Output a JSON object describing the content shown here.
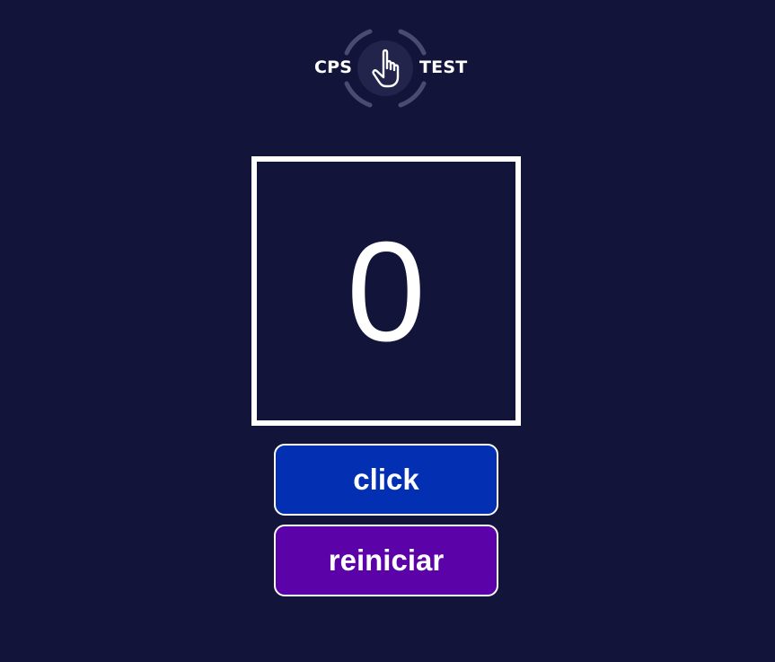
{
  "logo": {
    "left_text": "CPS",
    "right_text": "TEST",
    "icon": "pointer-hand-icon"
  },
  "counter": {
    "value": "0"
  },
  "buttons": {
    "click_label": "click",
    "reset_label": "reiniciar"
  },
  "colors": {
    "background": "#13143a",
    "click_button": "#0330b3",
    "reset_button": "#5b03a8",
    "ring": "#4a4b70",
    "text": "#ffffff"
  }
}
